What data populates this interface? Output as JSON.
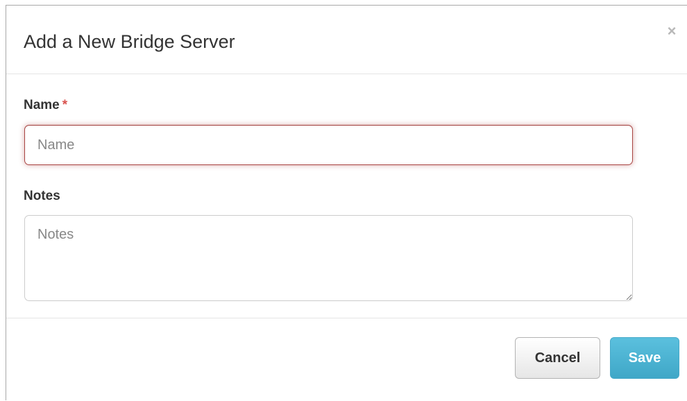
{
  "modal": {
    "title": "Add a New Bridge Server",
    "close_symbol": "×"
  },
  "form": {
    "name_label": "Name",
    "required_marker": "*",
    "name_placeholder": "Name",
    "name_value": "",
    "notes_label": "Notes",
    "notes_placeholder": "Notes",
    "notes_value": ""
  },
  "footer": {
    "cancel_label": "Cancel",
    "save_label": "Save"
  },
  "colors": {
    "required": "#d9534f",
    "error_border": "#a94442",
    "save_button": "#5bc0de"
  }
}
